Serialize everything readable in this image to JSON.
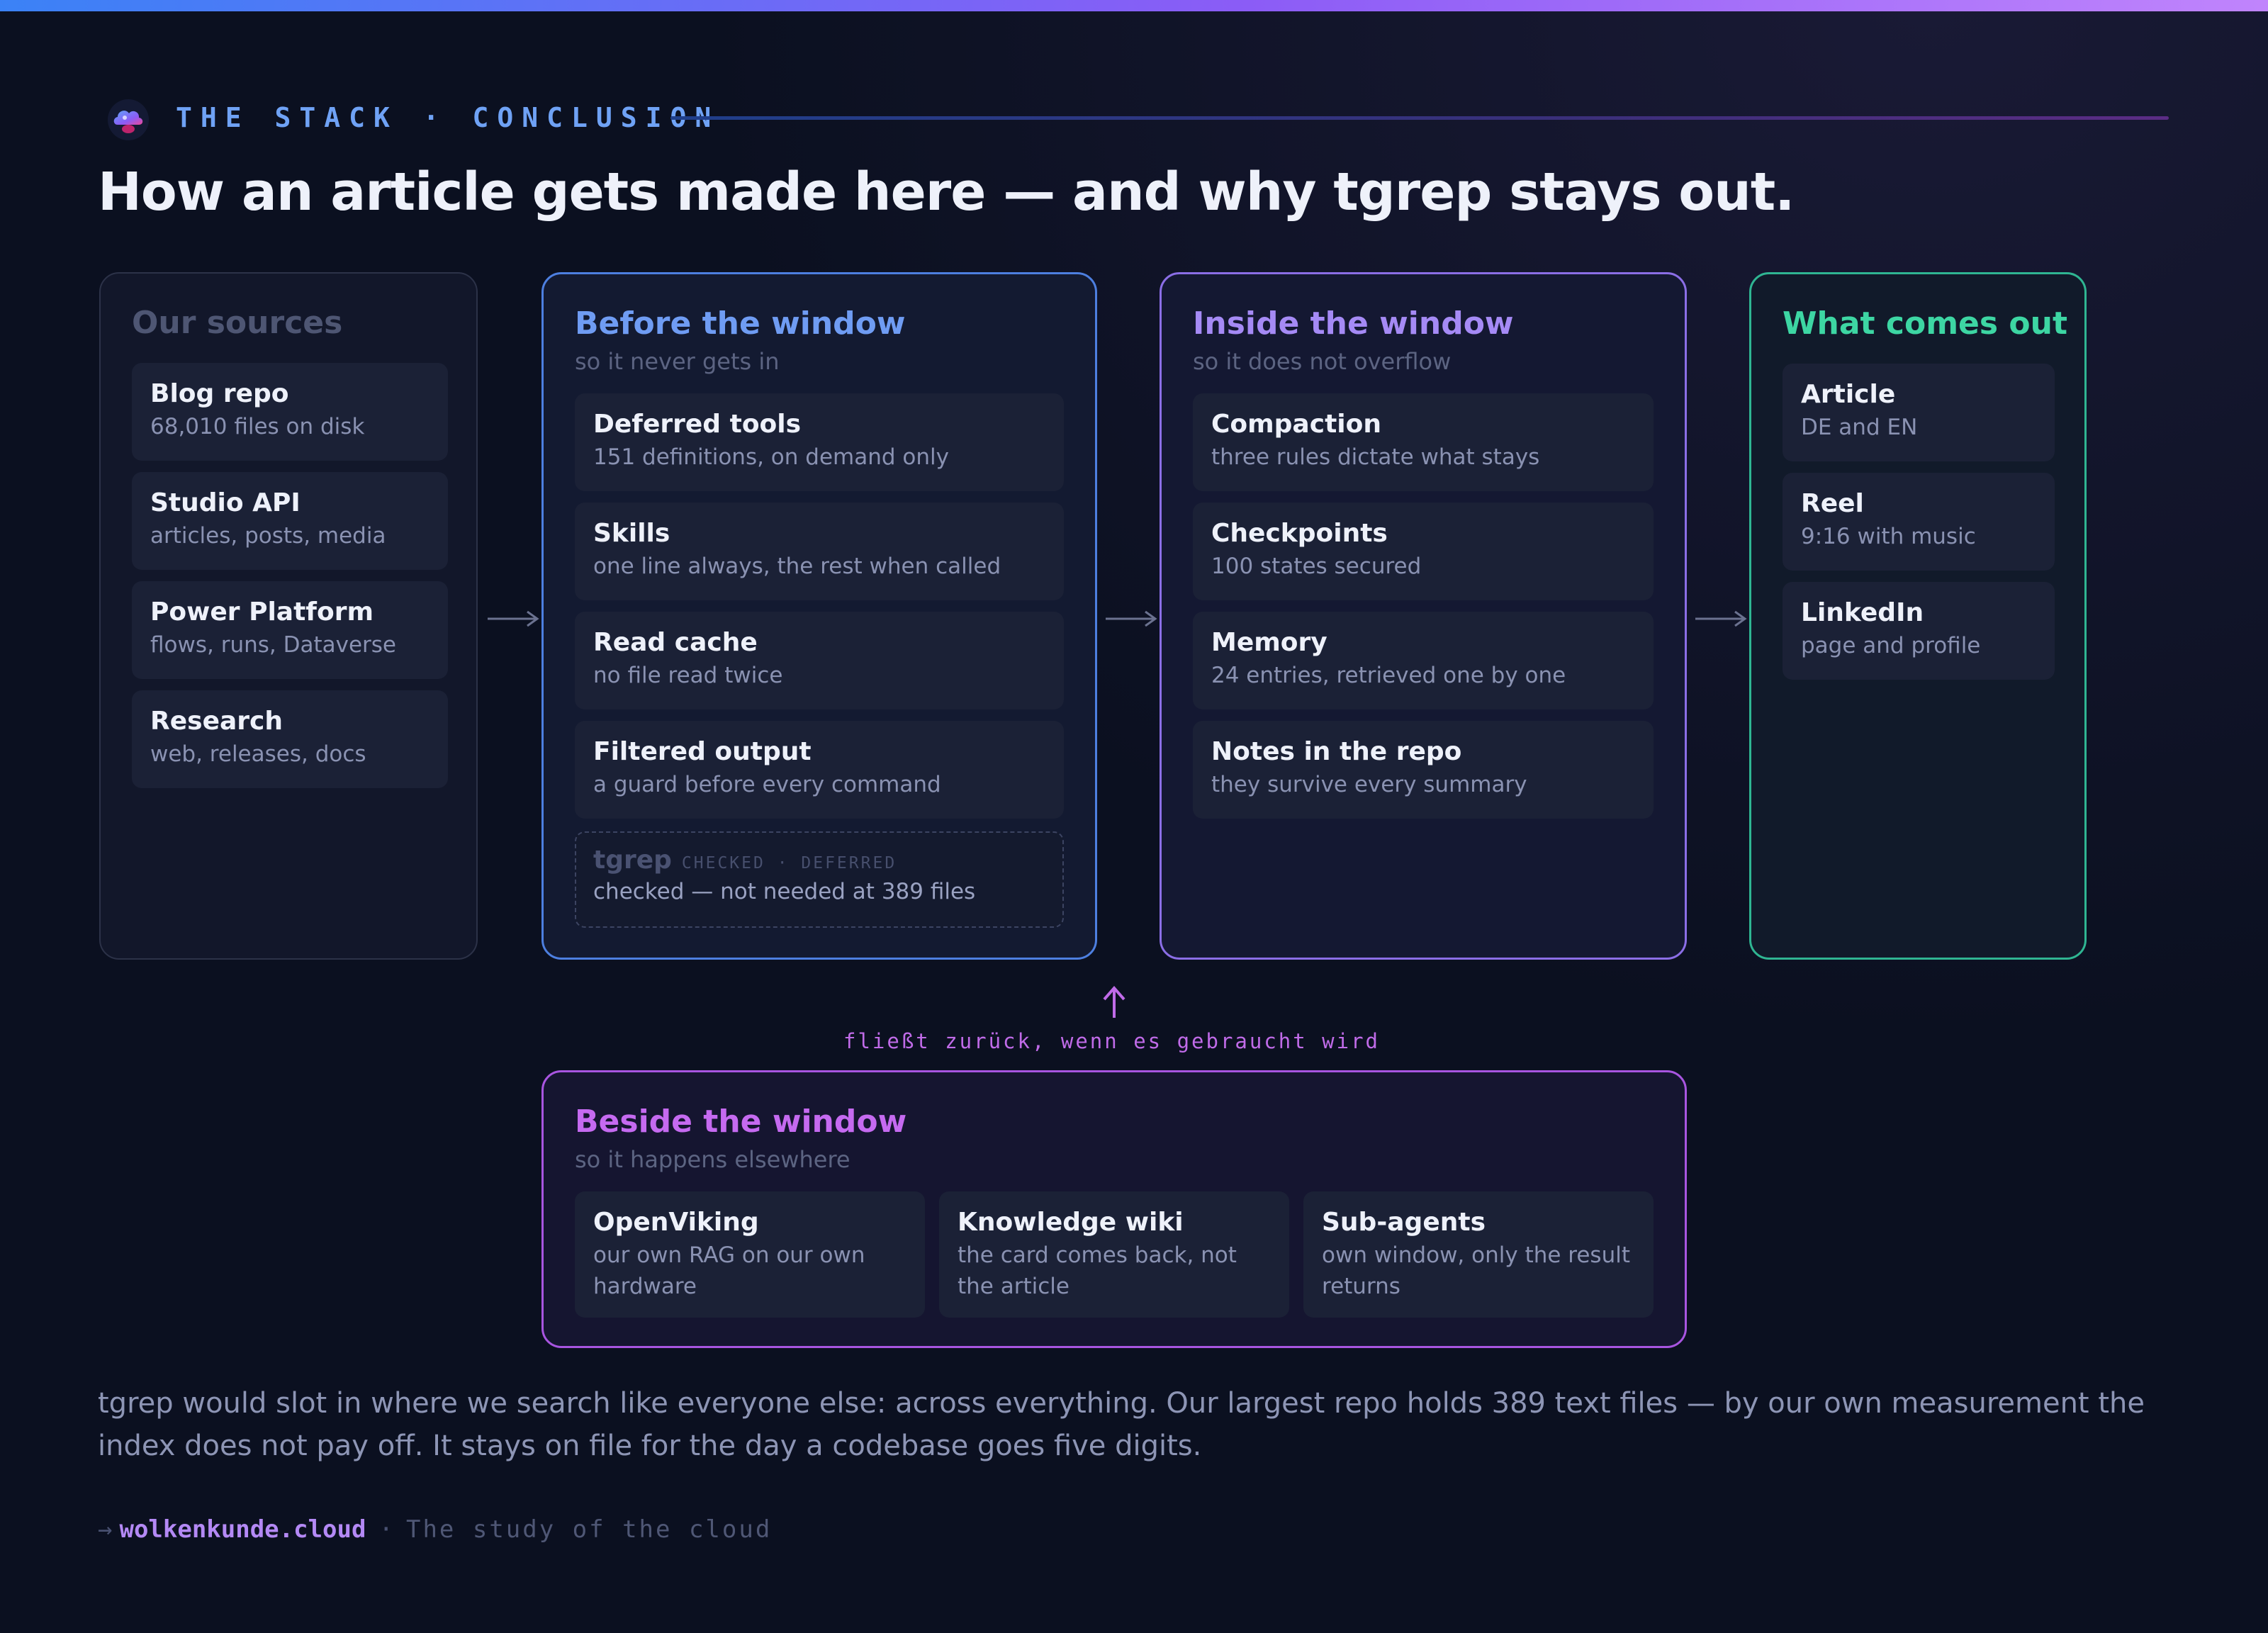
{
  "colors": {
    "accent_blue": "#4d7fe0",
    "accent_purple": "#8b6ee6",
    "accent_green": "#2fb592",
    "accent_magenta": "#a855e0",
    "background": "#0b1020"
  },
  "header": {
    "eyebrow": "THE STACK · CONCLUSION",
    "logo_icon": "cloud-logo-icon",
    "title": "How an article gets made here — and why tgrep stays out."
  },
  "sources": {
    "title": "Our sources",
    "items": [
      {
        "title": "Blog repo",
        "desc": "68,010 files on disk"
      },
      {
        "title": "Studio API",
        "desc": "articles, posts, media"
      },
      {
        "title": "Power Platform",
        "desc": "flows, runs, Dataverse"
      },
      {
        "title": "Research",
        "desc": "web, releases, docs"
      }
    ]
  },
  "before": {
    "title": "Before the window",
    "subtitle": "so it never gets in",
    "items": [
      {
        "title": "Deferred tools",
        "desc": "151 definitions, on demand only"
      },
      {
        "title": "Skills",
        "desc": "one line always, the rest when called"
      },
      {
        "title": "Read cache",
        "desc": "no file read twice"
      },
      {
        "title": "Filtered output",
        "desc": "a guard before every command"
      }
    ],
    "tgrep": {
      "name": "tgrep",
      "tag": "CHECKED · DEFERRED",
      "desc": "checked — not needed at 389 files"
    }
  },
  "inside": {
    "title": "Inside the window",
    "subtitle": "so it does not overflow",
    "items": [
      {
        "title": "Compaction",
        "desc": "three rules dictate what stays"
      },
      {
        "title": "Checkpoints",
        "desc": "100 states secured"
      },
      {
        "title": "Memory",
        "desc": "24 entries, retrieved one by one"
      },
      {
        "title": "Notes in the repo",
        "desc": "they survive every summary"
      }
    ]
  },
  "output": {
    "title": "What comes out",
    "items": [
      {
        "title": "Article",
        "desc": "DE and EN"
      },
      {
        "title": "Reel",
        "desc": "9:16 with music"
      },
      {
        "title": "LinkedIn",
        "desc": "page and profile"
      }
    ]
  },
  "flow_note": "fließt zurück, wenn es gebraucht wird",
  "beside": {
    "title": "Beside the window",
    "subtitle": "so it happens elsewhere",
    "items": [
      {
        "title": "OpenViking",
        "desc": "our own RAG on our own hardware"
      },
      {
        "title": "Knowledge wiki",
        "desc": "the card comes back, not the article"
      },
      {
        "title": "Sub-agents",
        "desc": "own window, only the result returns"
      }
    ]
  },
  "footer": {
    "text": "tgrep would slot in where we search like everyone else: across everything. Our largest repo holds 389 text files — by our own measurement the index does not pay off. It stays on file for the day a codebase goes five digits.",
    "arrow": "→",
    "domain": "wolkenkunde.cloud",
    "separator": "·",
    "tagline": "The study of the cloud"
  }
}
